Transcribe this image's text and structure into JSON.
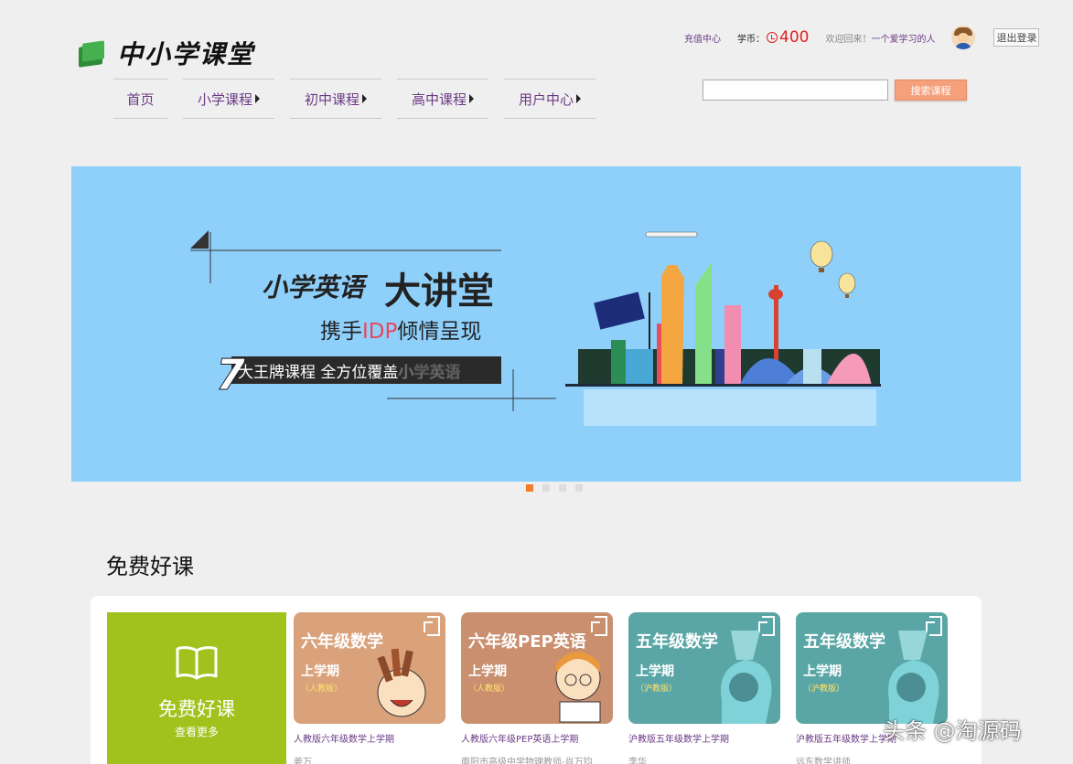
{
  "logo": {
    "text": "中小学课堂"
  },
  "nav": {
    "items": [
      {
        "label": "首页",
        "has_arrow": false
      },
      {
        "label": "小学课程",
        "has_arrow": true
      },
      {
        "label": "初中课程",
        "has_arrow": true
      },
      {
        "label": "高中课程",
        "has_arrow": true
      },
      {
        "label": "用户中心",
        "has_arrow": true
      }
    ]
  },
  "topbar": {
    "recharge": "充值中心",
    "coin_label": "学币：",
    "coin_value": "400",
    "welcome": "欢迎回来！",
    "username": "一个爱学习的人",
    "logout": "退出登录"
  },
  "search": {
    "value": "",
    "button": "搜索课程"
  },
  "banner": {
    "headline_a": "小学英语",
    "headline_b": "大讲堂",
    "sub_a": "携手",
    "sub_highlight": "IDP",
    "sub_b": "倾情呈现",
    "tag_num": "7",
    "tag_text": "大王牌课程 全方位覆盖",
    "tag_highlight": "小学英语",
    "colors": {
      "bg": "#8fd0fb",
      "accent": "#e8475b"
    }
  },
  "carousel": {
    "active_index": 0,
    "count": 4
  },
  "section": {
    "title": "免费好课"
  },
  "free_card": {
    "title": "免费好课",
    "more": "查看更多",
    "color": "#a1c21d",
    "icon": "open-book-icon"
  },
  "courses": [
    {
      "thumb_title": "六年级数学",
      "term": "上学期",
      "edition": "（人教版）",
      "name": "人教版六年级数学上学期",
      "teacher": "姜万",
      "color": "#d9a27b"
    },
    {
      "thumb_title": "六年级PEP英语",
      "term": "上学期",
      "edition": "（人教版）",
      "name": "人教版六年级PEP英语上学期",
      "teacher": "南阳市高级中学物理教师-肖万钧",
      "color": "#c98f6f"
    },
    {
      "thumb_title": "五年级数学",
      "term": "上学期",
      "edition": "（沪教版）",
      "name": "沪教版五年级数学上学期",
      "teacher": "李华",
      "color": "#5aa6a6"
    },
    {
      "thumb_title": "五年级数学",
      "term": "上学期",
      "edition": "（沪教版）",
      "name": "沪教版五年级数学上学期",
      "teacher": "远东数学讲师",
      "color": "#5aa6a6"
    }
  ],
  "watermark": "头条 @淘源码"
}
